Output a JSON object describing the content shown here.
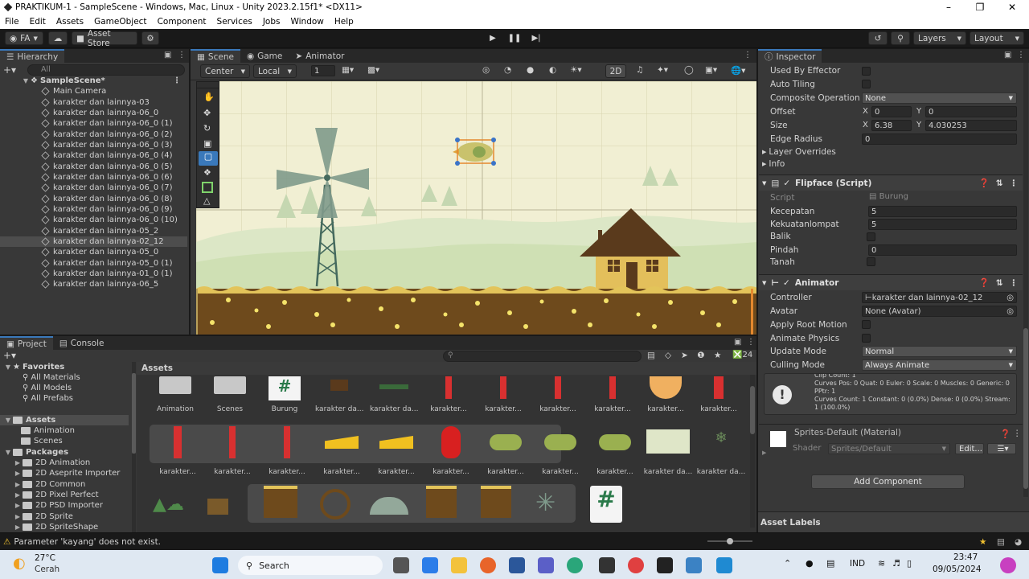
{
  "window": {
    "title": "PRAKTIKUM-1 - SampleScene - Windows, Mac, Linux - Unity 2023.2.15f1* <DX11>"
  },
  "menu": [
    "File",
    "Edit",
    "Assets",
    "GameObject",
    "Component",
    "Services",
    "Jobs",
    "Window",
    "Help"
  ],
  "toolbar": {
    "account": "FA",
    "asset_store": "Asset Store",
    "layers": "Layers",
    "layout": "Layout"
  },
  "hierarchy": {
    "tab": "Hierarchy",
    "search_placeholder": "All",
    "scene": "SampleScene*",
    "items": [
      "Main Camera",
      "karakter dan lainnya-03",
      "karakter dan lainnya-06_0",
      "karakter dan lainnya-06_0 (1)",
      "karakter dan lainnya-06_0 (2)",
      "karakter dan lainnya-06_0 (3)",
      "karakter dan lainnya-06_0 (4)",
      "karakter dan lainnya-06_0 (5)",
      "karakter dan lainnya-06_0 (6)",
      "karakter dan lainnya-06_0 (7)",
      "karakter dan lainnya-06_0 (8)",
      "karakter dan lainnya-06_0 (9)",
      "karakter dan lainnya-06_0 (10)",
      "karakter dan lainnya-05_2",
      "karakter dan lainnya-02_12",
      "karakter dan lainnya-05_0",
      "karakter dan lainnya-05_0 (1)",
      "karakter dan lainnya-01_0 (1)",
      "karakter dan lainnya-06_5"
    ]
  },
  "scene": {
    "tabs": [
      "Scene",
      "Game",
      "Animator"
    ],
    "pivot": "Center",
    "space": "Local",
    "snap": "1",
    "mode_2d": "2D"
  },
  "project": {
    "tabs": [
      "Project",
      "Console"
    ],
    "count": "24",
    "breadcrumb": "Assets",
    "favorites": {
      "label": "Favorites",
      "items": [
        "All Materials",
        "All Models",
        "All Prefabs"
      ]
    },
    "assets_tree": {
      "label": "Assets",
      "items": [
        "Animation",
        "Scenes"
      ]
    },
    "packages": {
      "label": "Packages",
      "items": [
        "2D Animation",
        "2D Aseprite Importer",
        "2D Common",
        "2D Pixel Perfect",
        "2D PSD Importer",
        "2D Sprite",
        "2D SpriteShape"
      ]
    },
    "row1": [
      "Animation",
      "Scenes",
      "Burung",
      "karakter da...",
      "karakter da...",
      "karakter...",
      "karakter...",
      "karakter...",
      "karakter...",
      "karakter...",
      "karakter..."
    ],
    "row2": [
      "karakter...",
      "karakter...",
      "karakter...",
      "karakter...",
      "karakter...",
      "karakter...",
      "karakter...",
      "karakter...",
      "karakter...",
      "karakter da...",
      "karakter da..."
    ]
  },
  "inspector": {
    "tab": "Inspector",
    "used_by_effector": "Used By Effector",
    "auto_tiling": "Auto Tiling",
    "composite_label": "Composite Operation",
    "composite_value": "None",
    "offset_label": "Offset",
    "offset_x": "0",
    "offset_y": "0",
    "size_label": "Size",
    "size_x": "6.38",
    "size_y": "4.030253",
    "x_lbl": "X",
    "y_lbl": "Y",
    "edge_label": "Edge Radius",
    "edge_value": "0",
    "layer_overrides": "Layer Overrides",
    "info": "Info",
    "flipface": {
      "title": "Flipface (Script)",
      "script_label": "Script",
      "script_value": "Burung",
      "kecepatan_label": "Kecepatan",
      "kecepatan_value": "5",
      "lompat_label": "Kekuatanlompat",
      "lompat_value": "5",
      "balik_label": "Balik",
      "pindah_label": "Pindah",
      "pindah_value": "0",
      "tanah_label": "Tanah"
    },
    "animator": {
      "title": "Animator",
      "controller_label": "Controller",
      "controller_value": "karakter dan lainnya-02_12",
      "avatar_label": "Avatar",
      "avatar_value": "None (Avatar)",
      "root_motion": "Apply Root Motion",
      "anim_physics": "Animate Physics",
      "update_label": "Update Mode",
      "update_value": "Normal",
      "culling_label": "Culling Mode",
      "culling_value": "Always Animate",
      "info_text": "Clip Count: 1\nCurves Pos: 0 Quat: 0 Euler: 0 Scale: 0 Muscles: 0 Generic: 0 PPtr: 1\nCurves Count: 1 Constant: 0 (0.0%) Dense: 0 (0.0%) Stream: 1 (100.0%)"
    },
    "material": {
      "title": "Sprites-Default (Material)",
      "shader_label": "Shader",
      "shader_value": "Sprites/Default",
      "edit": "Edit..."
    },
    "add_component": "Add Component",
    "asset_labels": "Asset Labels"
  },
  "status": {
    "warning": "Parameter 'kayang' does not exist."
  },
  "taskbar": {
    "weather_temp": "27°C",
    "weather_desc": "Cerah",
    "search": "Search",
    "lang": "IND",
    "time": "23:47",
    "date": "09/05/2024"
  },
  "colors": {
    "accent": "#3a79bb",
    "sky": "#f1f0d0",
    "ground": "#6e4a1c",
    "house": "#e3bf5b",
    "roof": "#5a3a1c"
  }
}
